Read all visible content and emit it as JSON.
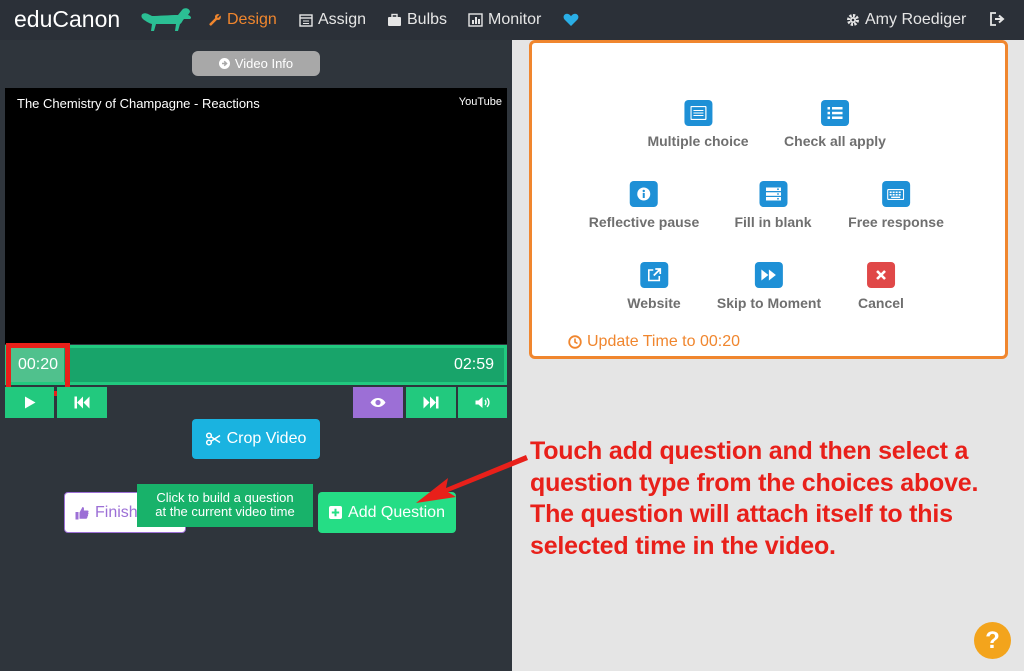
{
  "nav": {
    "brand": "eduCanon",
    "items": [
      {
        "label": "Design",
        "icon": "wrench-icon"
      },
      {
        "label": "Assign",
        "icon": "calendar-icon"
      },
      {
        "label": "Bulbs",
        "icon": "briefcase-icon"
      },
      {
        "label": "Monitor",
        "icon": "bar-chart-icon"
      }
    ],
    "user": "Amy Roediger"
  },
  "player": {
    "video_info_label": "Video Info",
    "title": "The Chemistry of Champagne - Reactions",
    "source": "YouTube",
    "current_time": "00:20",
    "duration": "02:59",
    "progress": 0.112
  },
  "actions": {
    "crop_label": "Crop Video",
    "finish_label": "Finish",
    "tooltip_line1": "Click to build a question",
    "tooltip_line2": "at the current video time",
    "add_question_label": "Add Question"
  },
  "question_types": [
    {
      "label": "Multiple choice",
      "icon": "list-icon"
    },
    {
      "label": "Check all apply",
      "icon": "checklist-icon"
    },
    {
      "label": "Reflective pause",
      "icon": "info-icon"
    },
    {
      "label": "Fill in blank",
      "icon": "server-icon"
    },
    {
      "label": "Free response",
      "icon": "keyboard-icon"
    },
    {
      "label": "Website",
      "icon": "external-link-icon"
    },
    {
      "label": "Skip to Moment",
      "icon": "fast-forward-icon"
    },
    {
      "label": "Cancel",
      "icon": "close-icon"
    }
  ],
  "update_time_label": "Update Time to 00:20",
  "annotation": {
    "lines": [
      "Touch add question and then select a",
      "question type from the choices above.",
      "The question will attach itself to this",
      "selected time in the video."
    ]
  },
  "colors": {
    "accent": "#f0862e",
    "green": "#22c97e",
    "purple": "#9c6fd6",
    "blue": "#1e90d6",
    "annotation_red": "#e8201a"
  }
}
